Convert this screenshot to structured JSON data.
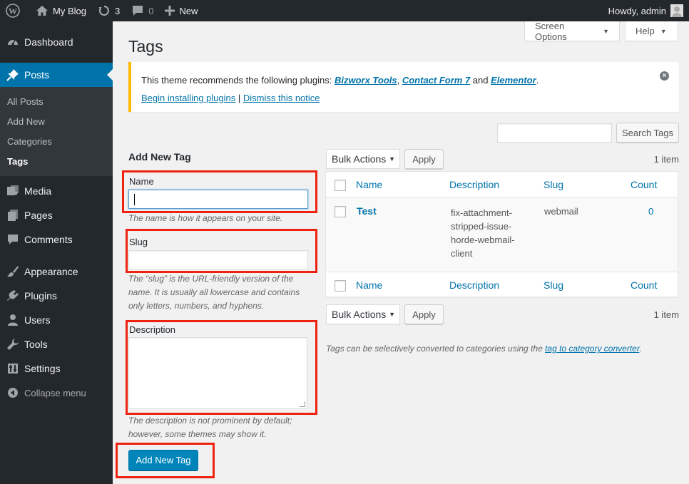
{
  "adminbar": {
    "site_name": "My Blog",
    "updates_count": "3",
    "comments_count": "0",
    "new_label": "New",
    "howdy": "Howdy, admin"
  },
  "sidebar": {
    "items": [
      {
        "label": "Dashboard"
      },
      {
        "label": "Posts"
      },
      {
        "label": "Media"
      },
      {
        "label": "Pages"
      },
      {
        "label": "Comments"
      },
      {
        "label": "Appearance"
      },
      {
        "label": "Plugins"
      },
      {
        "label": "Users"
      },
      {
        "label": "Tools"
      },
      {
        "label": "Settings"
      },
      {
        "label": "Collapse menu"
      }
    ],
    "posts_submenu": [
      "All Posts",
      "Add New",
      "Categories",
      "Tags"
    ]
  },
  "header": {
    "screen_options": "Screen Options",
    "help": "Help",
    "title": "Tags"
  },
  "notice": {
    "text_before": "This theme recommends the following plugins: ",
    "plugins": [
      "Bizworx Tools",
      "Contact Form 7",
      "Elementor"
    ],
    "sep1": ", ",
    "and": " and ",
    "end": ".",
    "begin_link": "Begin installing plugins",
    "pipe": " | ",
    "dismiss_link": "Dismiss this notice"
  },
  "search": {
    "button": "Search Tags",
    "value": ""
  },
  "form": {
    "heading": "Add New Tag",
    "name_label": "Name",
    "name_value": "",
    "name_help": "The name is how it appears on your site.",
    "slug_label": "Slug",
    "slug_value": "",
    "slug_help": "The “slug” is the URL-friendly version of the name. It is usually all lowercase and contains only letters, numbers, and hyphens.",
    "desc_label": "Description",
    "desc_value": "",
    "desc_help": "The description is not prominent by default; however, some themes may show it.",
    "submit": "Add New Tag"
  },
  "table": {
    "bulk_actions": "Bulk Actions",
    "apply": "Apply",
    "items_count": "1 item",
    "columns": [
      "Name",
      "Description",
      "Slug",
      "Count"
    ],
    "rows": [
      {
        "name": "Test",
        "description": "fix-attachment-stripped-issue-horde-webmail-client",
        "description_lines": [
          "fix-attachment-",
          "stripped-issue-",
          "horde-webmail-",
          "client"
        ],
        "slug": "webmail",
        "count": "0"
      }
    ]
  },
  "footer_note": {
    "text": "Tags can be selectively converted to categories using the ",
    "link": "tag to category converter",
    "end": "."
  },
  "colors": {
    "adminbar_bg": "#23282d",
    "accent": "#0073aa",
    "primary_button": "#0085ba",
    "notice_border": "#ffb900",
    "highlight_box": "#ee1111"
  }
}
